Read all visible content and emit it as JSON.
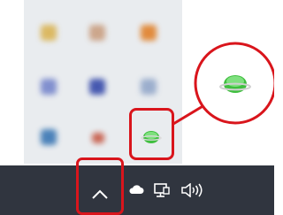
{
  "tray_overflow": {
    "blurred_icons": [
      {
        "icon": "blurred-app-icon-1",
        "color": "#d9b04a"
      },
      {
        "icon": "blurred-app-icon-2",
        "color": "#c79a7a"
      },
      {
        "icon": "blurred-app-icon-3",
        "color": "#e07a1e"
      },
      {
        "icon": "blurred-app-icon-4",
        "color": "#6f7fc9"
      },
      {
        "icon": "blurred-app-icon-5",
        "color": "#2a3fa5"
      },
      {
        "icon": "blurred-app-icon-6",
        "color": "#8ea3c7"
      },
      {
        "icon": "blurred-app-icon-7",
        "color": "#2f6fb0"
      },
      {
        "icon": "blurred-app-icon-8",
        "color": "#c44f3a"
      }
    ],
    "highlighted_icon": "green-globe-icon"
  },
  "callout": {
    "icon": "green-globe-icon-magnified"
  },
  "taskbar": {
    "icons": [
      "chevron-up-icon",
      "cloud-icon",
      "network-icon",
      "volume-icon"
    ]
  },
  "colors": {
    "highlight": "#d9151c",
    "taskbar": "#30353f",
    "popup": "#e9ecef",
    "globe": "#3fbf3f"
  }
}
